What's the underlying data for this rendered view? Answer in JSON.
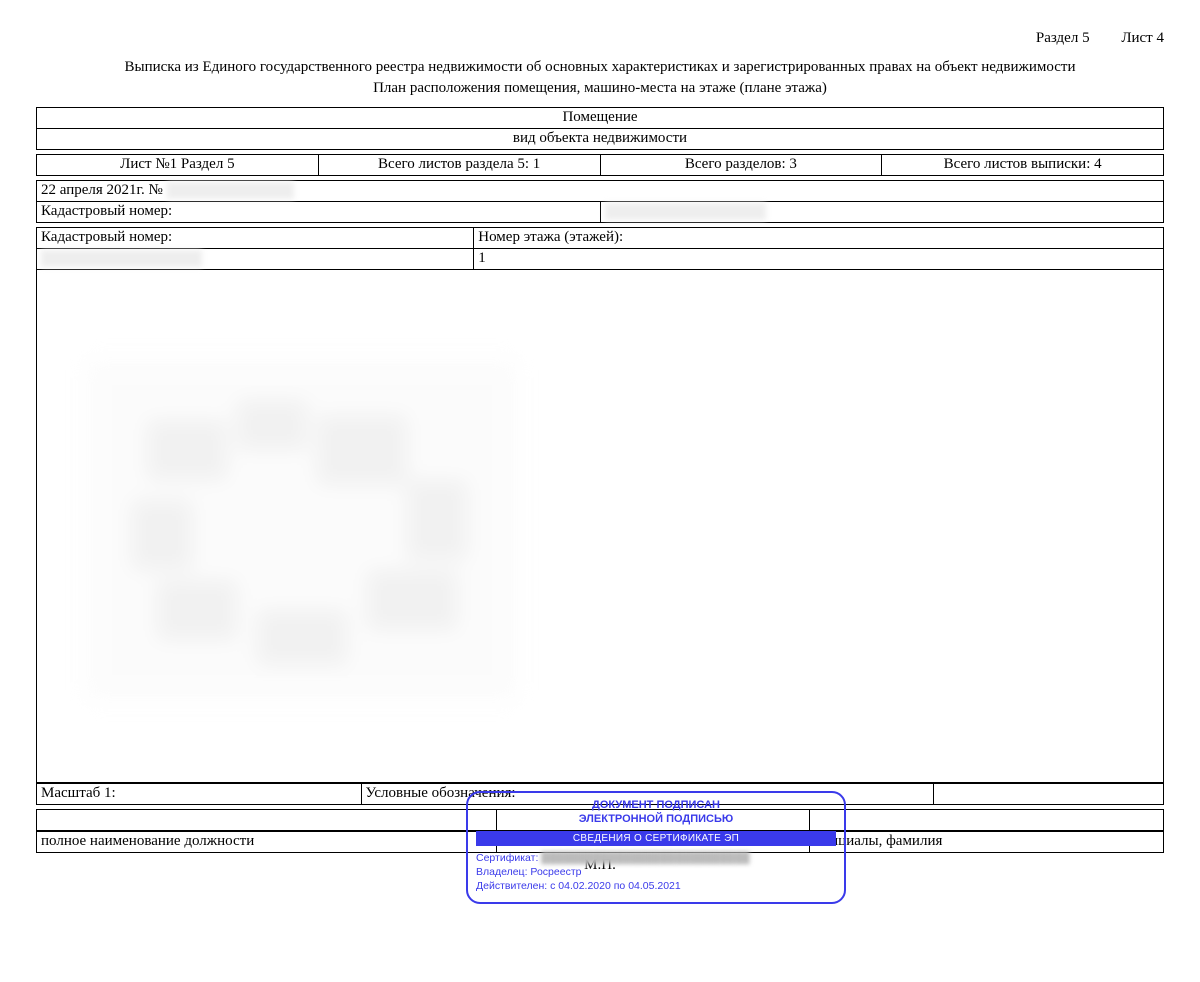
{
  "header": {
    "section_label": "Раздел 5",
    "sheet_label": "Лист 4",
    "title1": "Выписка из Единого государственного реестра недвижимости об основных характеристиках и зарегистрированных правах на объект недвижимости",
    "title2": "План расположения помещения, машино-места на этаже (плане этажа)"
  },
  "object_type": {
    "name": "Помещение",
    "caption": "вид объекта недвижимости"
  },
  "counts": {
    "sheet_section": "Лист №1  Раздел 5",
    "section_sheets": "Всего листов раздела 5: 1",
    "total_sections": "Всего разделов: 3",
    "total_sheets": "Всего листов выписки: 4"
  },
  "date_row": {
    "date": "22 апреля 2021г. №",
    "redacted": "████████████"
  },
  "cadastral": {
    "label": "Кадастровый номер:",
    "value_redacted": "██:██:███████:███"
  },
  "cadastral2_label": "Кадастровый номер:",
  "cadastral2_value_redacted": "██:██:███████:███",
  "floor_label": "Номер этажа (этажей):",
  "floor_value": "1",
  "scale_label": "Масштаб 1:",
  "legend_label": "Условные обозначения:",
  "sign_row": {
    "left": "полное наименование должности",
    "right": "инициалы, фамилия"
  },
  "mp": "М.П.",
  "stamp": {
    "line1": "ДОКУМЕНТ ПОДПИСАН",
    "line2": "ЭЛЕКТРОННОЙ ПОДПИСЬЮ",
    "bar": "СВЕДЕНИЯ О СЕРТИФИКАТЕ ЭП",
    "cert_label": "Сертификат:",
    "cert_value_redacted": "████████████████████████████",
    "owner_label": "Владелец:",
    "owner_value": "Росреестр",
    "valid_label": "Действителен:",
    "valid_value": "с 04.02.2020 по 04.05.2021"
  }
}
